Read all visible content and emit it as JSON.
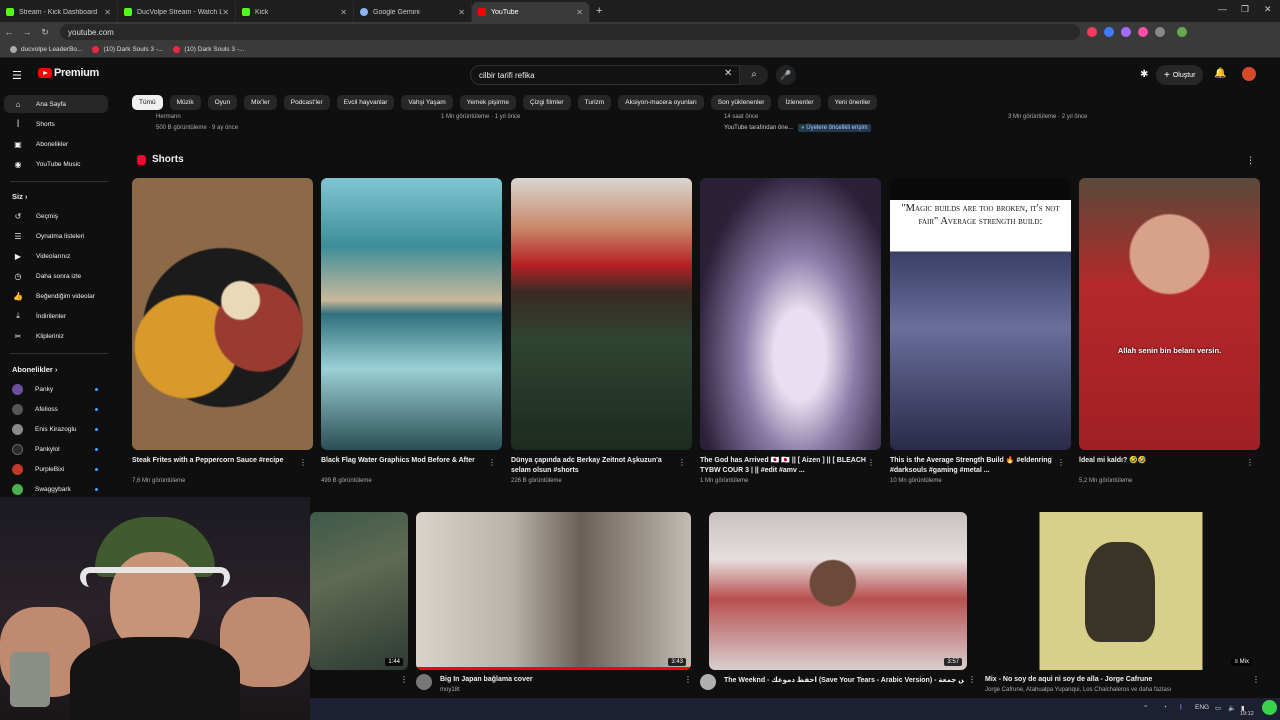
{
  "browser": {
    "tabs": [
      {
        "title": "Stream - Kick Dashboard",
        "color": "#53fc18"
      },
      {
        "title": "DucVolpe Stream - Watch Live",
        "color": "#53fc18"
      },
      {
        "title": "Kick",
        "color": "#53fc18"
      },
      {
        "title": "Google Gemini",
        "color": "#8ab4f8"
      },
      {
        "title": "YouTube",
        "color": "#ff0000"
      }
    ],
    "url": "youtube.com",
    "bookmarks": [
      "ducvolpe LeaderBo...",
      "(10) Dark Souls 3 -...",
      "(10) Dark Souls 3 -..."
    ]
  },
  "header": {
    "logo_text": "Premium",
    "search_value": "cilbir tarifi refika",
    "create_label": "Oluştur"
  },
  "chips": [
    "Tümü",
    "Müzik",
    "Oyun",
    "Mix'ler",
    "Podcast'ler",
    "Evcil hayvanlar",
    "Vahşi Yaşam",
    "Yemek pişirme",
    "Çizgi filmler",
    "Turizm",
    "Aksiyon-macera oyunları",
    "Son yüklenenler",
    "İzlenenler",
    "Yeni öneriler"
  ],
  "sidebar": {
    "main": [
      "Ana Sayfa",
      "Shorts",
      "Abonelikler",
      "YouTube Music"
    ],
    "you_heading": "Siz",
    "you_items": [
      "Geçmiş",
      "Oynatma listeleri",
      "Videolarınız",
      "Daha sonra izle",
      "Beğendiğim videolar",
      "İndirilenler",
      "Klipleriniz"
    ],
    "subs_heading": "Abonelikler",
    "subs": [
      "Panky",
      "Afelioss",
      "Enis Kirazoglu",
      "Pankylol",
      "PurpleBixi",
      "Swaggybark"
    ]
  },
  "top_row": {
    "channel": "Hermann",
    "v1_meta": "500 B görüntüleme · 9 ay önce",
    "v2_meta": "1 Mn görüntüleme · 1 yıl önce",
    "v3_meta": "14 saat önce",
    "v3_channel": "YouTube tarafından öne...",
    "v3_badge": "Üyelere öncelikli erişim",
    "v4_meta": "3 Mn görüntüleme · 2 yıl önce"
  },
  "shorts": {
    "heading": "Shorts",
    "items": [
      {
        "title": "Steak Frites with a Peppercorn Sauce #recipe",
        "views": "7,6 Mn görüntüleme"
      },
      {
        "title": "Black Flag Water Graphics Mod Before & After",
        "views": "499 B görüntüleme"
      },
      {
        "title": "Dünya çapında adc Berkay Zeitnot Aşkuzun'a selam olsun #shorts",
        "views": "226 B görüntüleme"
      },
      {
        "title": "The God has Arrived 🇯🇵 🇯🇵 || [ Aizen ] || [ BLEACH TYBW COUR 3 | || #edit #amv ...",
        "views": "1 Mn görüntüleme"
      },
      {
        "title": "This is the Average Strength Build 🔥 #eldenring #darksouls #gaming #metal ...",
        "views": "10 Mn görüntüleme"
      },
      {
        "title": "İdeal mi kaldı? 🤣🤣",
        "views": "5,2 Mn görüntüleme"
      }
    ],
    "meme_text": "\"Magic builds are too broken, it's not fair\" Average strength build:",
    "caption_text": "Allah senin bin belanı versin."
  },
  "videos": [
    {
      "title": "",
      "channel": "",
      "duration": "1:44"
    },
    {
      "title": "Big In Japan bağlama cover",
      "channel": "moy18t",
      "duration": "3:43"
    },
    {
      "title": "The Weeknd - احفظ دموعك (Save Your Tears - Arabic Version) - خليس جمعة",
      "channel": "",
      "duration": "3:57"
    },
    {
      "title": "Mix - No soy de aqui ni soy de alla - Jorge Cafrune",
      "channel": "Jorge Cafrune, Atahualpa Yupanqui, Los Chalchaleros ve daha fazlası",
      "duration": "Mix"
    }
  ],
  "taskbar": {
    "lang": "ENG",
    "time": "19:12"
  }
}
